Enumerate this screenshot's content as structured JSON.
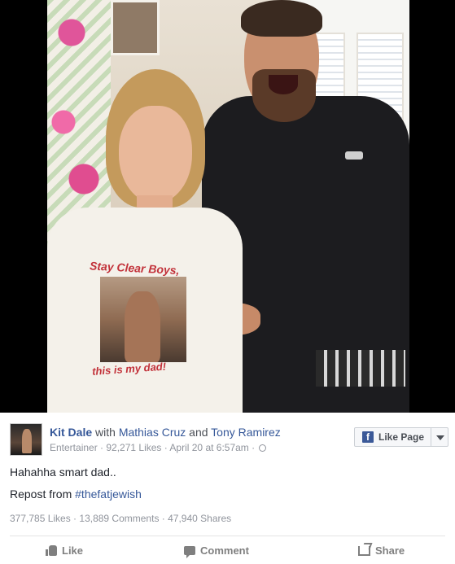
{
  "photo": {
    "shirt_text_top": "Stay Clear Boys,",
    "shirt_text_bottom": "this is my dad!"
  },
  "post": {
    "author": "Kit Dale",
    "with_word": "with",
    "tagged_1": "Mathias Cruz",
    "and_word": "and",
    "tagged_2": "Tony Ramirez",
    "meta": "Entertainer · 92,271 Likes · April 20 at 6:57am ·",
    "like_page_label": "Like Page",
    "text_line_1": "Hahahha smart dad..",
    "text_line_2_prefix": "Repost from",
    "hashtag": "#thefatjewish",
    "stats": "377,785 Likes · 13,889 Comments · 47,940 Shares"
  },
  "actions": {
    "like": "Like",
    "comment": "Comment",
    "share": "Share"
  },
  "icons": {
    "like_page": "facebook-f-icon",
    "dropdown": "caret-down-icon",
    "privacy": "globe-icon",
    "like": "thumbs-up-icon",
    "comment": "speech-bubble-icon",
    "share": "share-arrow-icon"
  },
  "colors": {
    "link": "#365899",
    "facebook_blue": "#3b5998",
    "muted": "#90949c",
    "shirt_text": "#c2323a"
  }
}
